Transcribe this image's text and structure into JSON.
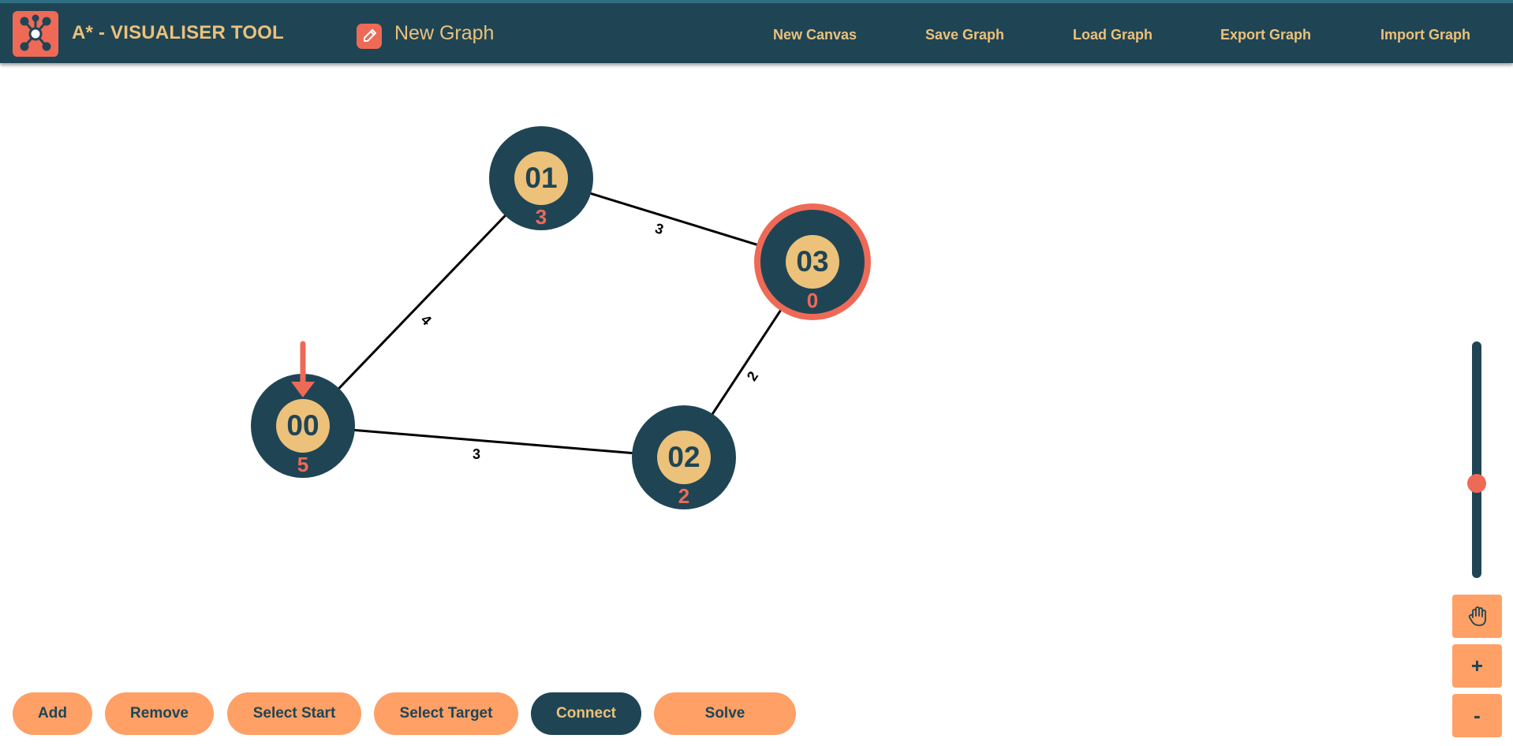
{
  "header": {
    "app_title": "A* - VISUALISER TOOL",
    "graph_name": "New Graph",
    "nav": [
      "New Canvas",
      "Save Graph",
      "Load Graph",
      "Export Graph",
      "Import Graph"
    ]
  },
  "graph": {
    "start_node": "00",
    "target_node": "03",
    "nodes": [
      {
        "id": "00",
        "label": "00",
        "heuristic": "5"
      },
      {
        "id": "01",
        "label": "01",
        "heuristic": "3"
      },
      {
        "id": "02",
        "label": "02",
        "heuristic": "2"
      },
      {
        "id": "03",
        "label": "03",
        "heuristic": "0"
      }
    ],
    "edges": [
      {
        "from": "00",
        "to": "01",
        "weight": "4"
      },
      {
        "from": "01",
        "to": "03",
        "weight": "3"
      },
      {
        "from": "00",
        "to": "02",
        "weight": "3"
      },
      {
        "from": "02",
        "to": "03",
        "weight": "2"
      }
    ]
  },
  "toolbar": {
    "add": "Add",
    "remove": "Remove",
    "select_start": "Select Start",
    "select_target": "Select Target",
    "connect": "Connect",
    "solve": "Solve",
    "active": "Connect"
  },
  "zoom": {
    "level": 0.4,
    "plus": "+",
    "minus": "-",
    "pan_icon": "hand-icon"
  },
  "colors": {
    "header": "#1f4555",
    "accent": "#ecc17a",
    "node_dark": "#1f4555",
    "node_inner": "#ecc17a",
    "heuristic": "#ee6a57",
    "target_ring": "#ee6a57",
    "button": "#ffa066"
  }
}
